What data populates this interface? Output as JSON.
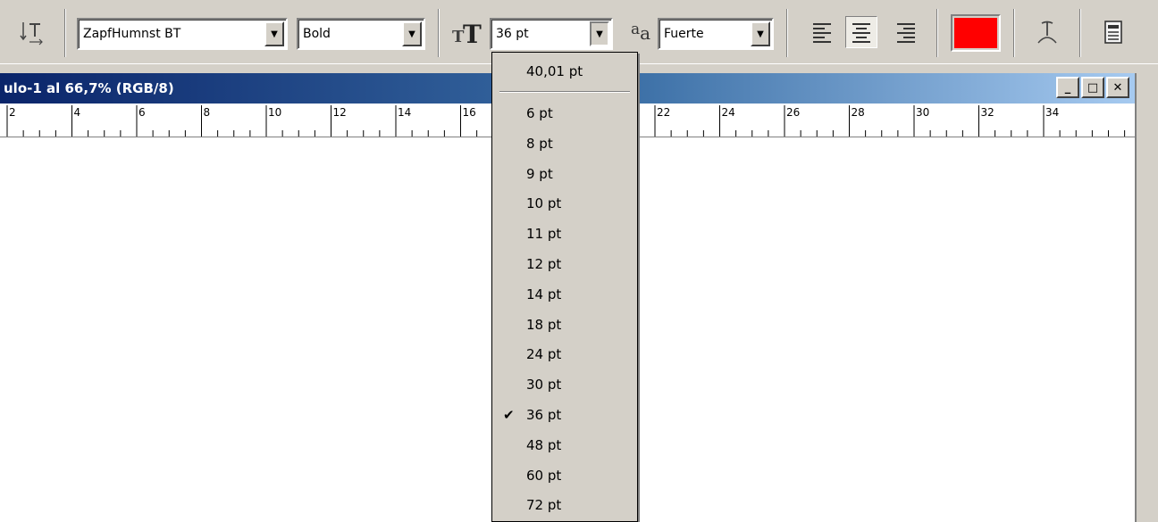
{
  "toolbar": {
    "text_orient_icon": "text-orientation-icon",
    "font_family": "ZapfHumnst BT",
    "font_style": "Bold",
    "size_icon": "font-size-icon",
    "font_size": "36 pt",
    "antialias_icon": "anti-alias-icon",
    "antialias_glyph": "a",
    "antialias_glyph_small": "a",
    "antialias": "Fuerte",
    "align_left_icon": "align-left-icon",
    "align_center_icon": "align-center-icon",
    "align_right_icon": "align-right-icon",
    "text_color": "#ff0000",
    "warp_icon": "warp-text-icon",
    "palettes_icon": "palettes-icon"
  },
  "document": {
    "title": "ulo-1 al 66,7% (RGB/8)",
    "controls": {
      "minimize": "_",
      "maximize": "□",
      "close": "✕"
    },
    "ruler_labels": [
      "2",
      "4",
      "6",
      "8",
      "10",
      "12",
      "14",
      "16",
      "22",
      "24",
      "26",
      "28",
      "30",
      "32",
      "34"
    ]
  },
  "size_dropdown": {
    "top_item": "40,01 pt",
    "items": [
      {
        "label": "6 pt",
        "checked": false
      },
      {
        "label": "8 pt",
        "checked": false
      },
      {
        "label": "9 pt",
        "checked": false
      },
      {
        "label": "10 pt",
        "checked": false
      },
      {
        "label": "11 pt",
        "checked": false
      },
      {
        "label": "12 pt",
        "checked": false
      },
      {
        "label": "14 pt",
        "checked": false
      },
      {
        "label": "18 pt",
        "checked": false
      },
      {
        "label": "24 pt",
        "checked": false
      },
      {
        "label": "30 pt",
        "checked": false
      },
      {
        "label": "36 pt",
        "checked": true
      },
      {
        "label": "48 pt",
        "checked": false
      },
      {
        "label": "60 pt",
        "checked": false
      },
      {
        "label": "72 pt",
        "checked": false
      }
    ],
    "check_glyph": "✔"
  }
}
